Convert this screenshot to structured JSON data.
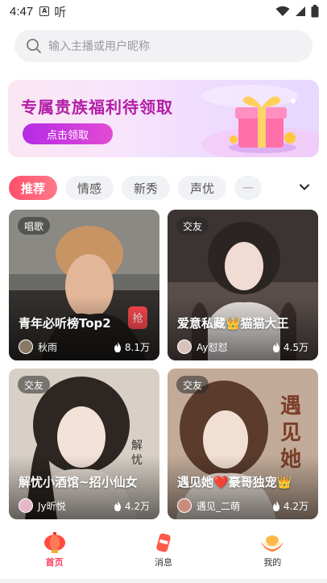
{
  "status_bar": {
    "time": "4:47",
    "a_badge": "A",
    "ting": "听"
  },
  "search": {
    "placeholder": "输入主播或用户昵称"
  },
  "banner": {
    "title": "专属贵族福利待领取",
    "button_label": "点击领取"
  },
  "tabs": [
    {
      "label": "推荐",
      "active": true
    },
    {
      "label": "情感",
      "active": false
    },
    {
      "label": "新秀",
      "active": false
    },
    {
      "label": "声优",
      "active": false
    }
  ],
  "rooms": [
    {
      "tag": "唱歌",
      "title": "青年必听榜Top2",
      "host": "秋雨",
      "heat": "8.1万"
    },
    {
      "tag": "交友",
      "title": "爱意私藏👑猫猫大王",
      "host": "Ay怼怼",
      "heat": "4.5万"
    },
    {
      "tag": "交友",
      "title": "解忧小酒馆~招小仙女",
      "host": "Jy昕悦",
      "heat": "4.2万"
    },
    {
      "tag": "交友",
      "title": "遇见她❤️豪哥独宠👑",
      "host": "遇见_二萌",
      "heat": "4.2万"
    }
  ],
  "bottom_nav": [
    {
      "label": "首页",
      "icon": "lantern-icon",
      "active": true
    },
    {
      "label": "消息",
      "icon": "message-can-icon",
      "active": false
    },
    {
      "label": "我的",
      "icon": "ingot-icon",
      "active": false
    }
  ],
  "colors": {
    "accent": "#ff3e5e",
    "banner_title": "#b21ea6",
    "banner_button": "#c13adf"
  }
}
